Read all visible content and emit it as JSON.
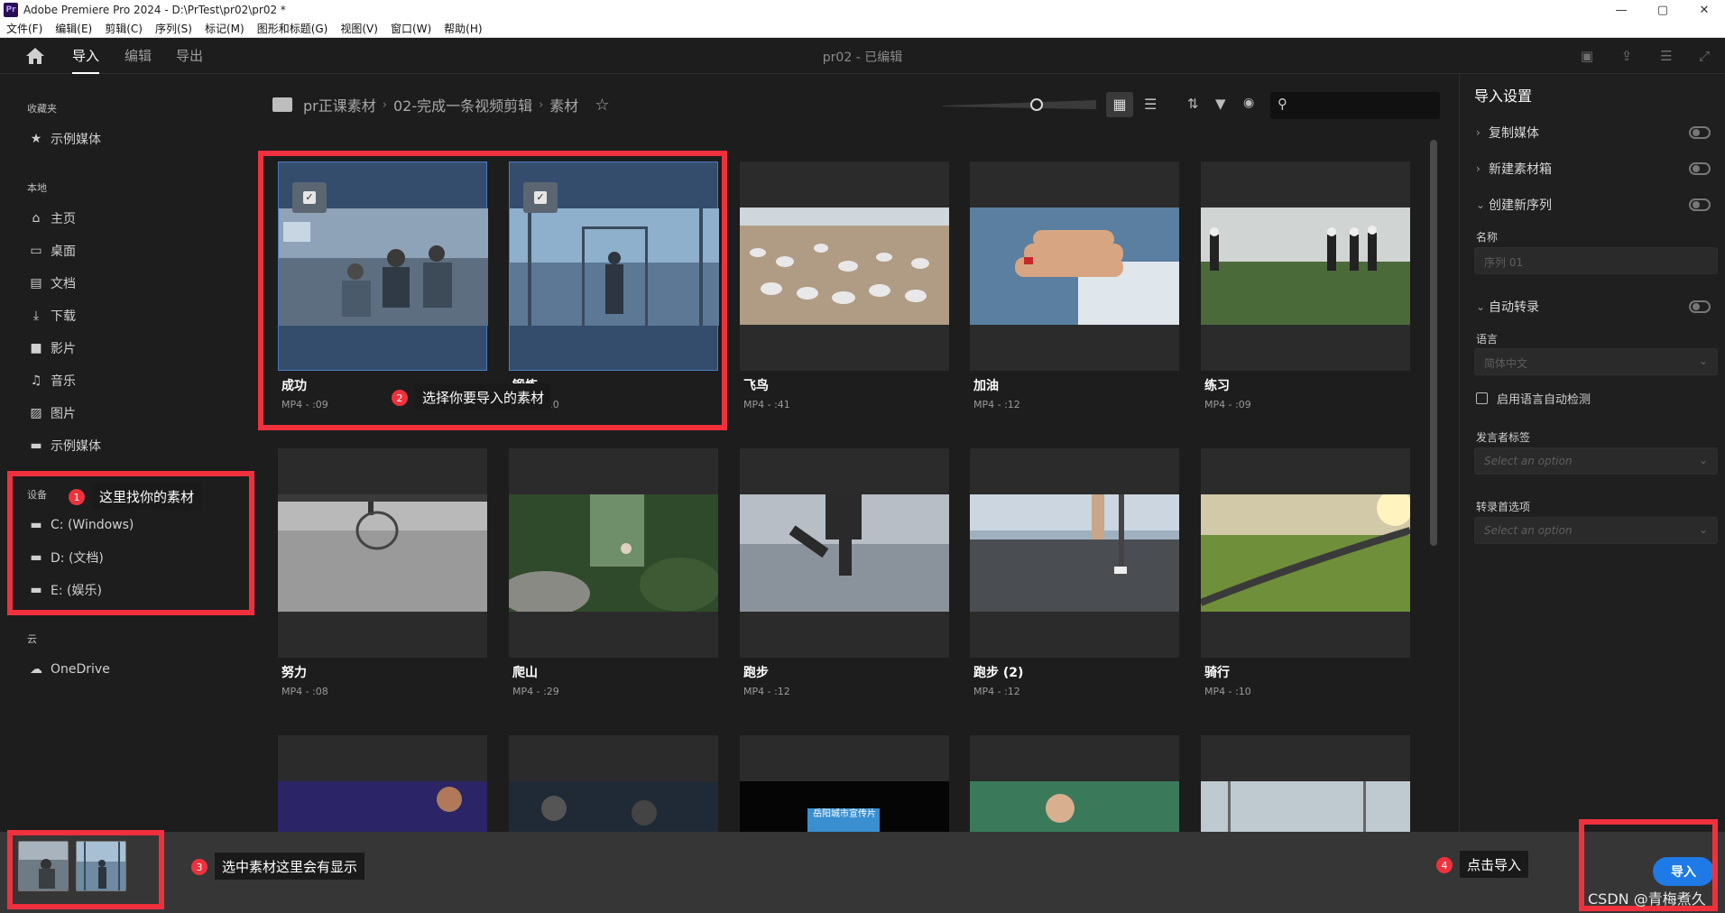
{
  "window": {
    "title": "Adobe Premiere Pro 2024 - D:\\PrTest\\pr02\\pr02 *",
    "logo": "Pr",
    "controls": [
      "—",
      "▢",
      "✕"
    ]
  },
  "menu": [
    "文件(F)",
    "编辑(E)",
    "剪辑(C)",
    "序列(S)",
    "标记(M)",
    "图形和标题(G)",
    "视图(V)",
    "窗口(W)",
    "帮助(H)"
  ],
  "header": {
    "tabs": [
      "导入",
      "编辑",
      "导出"
    ],
    "active_tab": "导入",
    "doc_title": "pr02 - 已编辑"
  },
  "sidebar": {
    "favorites_heading": "收藏夹",
    "favorites": [
      {
        "label": "示例媒体",
        "icon": "star-icon"
      }
    ],
    "local_heading": "本地",
    "local": [
      {
        "label": "主页",
        "icon": "home-icon"
      },
      {
        "label": "桌面",
        "icon": "monitor-icon"
      },
      {
        "label": "文档",
        "icon": "document-icon"
      },
      {
        "label": "下载",
        "icon": "download-icon"
      },
      {
        "label": "影片",
        "icon": "video-icon"
      },
      {
        "label": "音乐",
        "icon": "music-icon"
      },
      {
        "label": "图片",
        "icon": "image-icon"
      },
      {
        "label": "示例媒体",
        "icon": "folder-icon"
      }
    ],
    "devices_heading": "设备",
    "devices": [
      {
        "label": "C: (Windows)",
        "icon": "folder-icon"
      },
      {
        "label": "D: (文档)",
        "icon": "folder-icon"
      },
      {
        "label": "E: (娱乐)",
        "icon": "folder-icon"
      }
    ],
    "cloud_heading": "云",
    "cloud": [
      {
        "label": "OneDrive",
        "icon": "cloud-icon"
      }
    ]
  },
  "breadcrumb": [
    "pr正课素材",
    "02-完成一条视频剪辑",
    "素材"
  ],
  "search": {
    "placeholder": ""
  },
  "media": [
    {
      "name": "成功",
      "meta": "MP4 - :09",
      "selected": true
    },
    {
      "name": "锻炼",
      "meta": "MP4 - :10",
      "selected": true
    },
    {
      "name": "飞鸟",
      "meta": "MP4 - :41",
      "selected": false
    },
    {
      "name": "加油",
      "meta": "MP4 - :12",
      "selected": false
    },
    {
      "name": "练习",
      "meta": "MP4 - :09",
      "selected": false
    },
    {
      "name": "努力",
      "meta": "MP4 - :08",
      "selected": false
    },
    {
      "name": "爬山",
      "meta": "MP4 - :29",
      "selected": false
    },
    {
      "name": "跑步",
      "meta": "MP4 - :12",
      "selected": false
    },
    {
      "name": "跑步 (2)",
      "meta": "MP4 - :12",
      "selected": false
    },
    {
      "name": "骑行",
      "meta": "MP4 - :10",
      "selected": false
    }
  ],
  "thumb_text_row3": "岳阳城市宣传片",
  "import_settings": {
    "title": "导入设置",
    "copy_media": "复制媒体",
    "new_bin": "新建素材箱",
    "create_sequence": "创建新序列",
    "name_label": "名称",
    "name_value": "序列 01",
    "auto_transcribe": "自动转录",
    "language_label": "语言",
    "language_value": "简体中文",
    "auto_detect": "启用语言自动检测",
    "speaker_label": "发言者标签",
    "speaker_value": "Select an option",
    "transcribe_pref_label": "转录首选项",
    "transcribe_pref_value": "Select an option"
  },
  "import_button": "导入",
  "annotations": {
    "a1": {
      "num": "1",
      "text": "这里找你的素材"
    },
    "a2": {
      "num": "2",
      "text": "选择你要导入的素材"
    },
    "a3": {
      "num": "3",
      "text": "选中素材这里会有显示"
    },
    "a4": {
      "num": "4",
      "text": "点击导入"
    }
  },
  "watermark": "CSDN @青梅煮久",
  "colors": {
    "accent": "#1e7ae6",
    "selected_tile": "#344d6c",
    "annotation_red": "#f0313d"
  }
}
